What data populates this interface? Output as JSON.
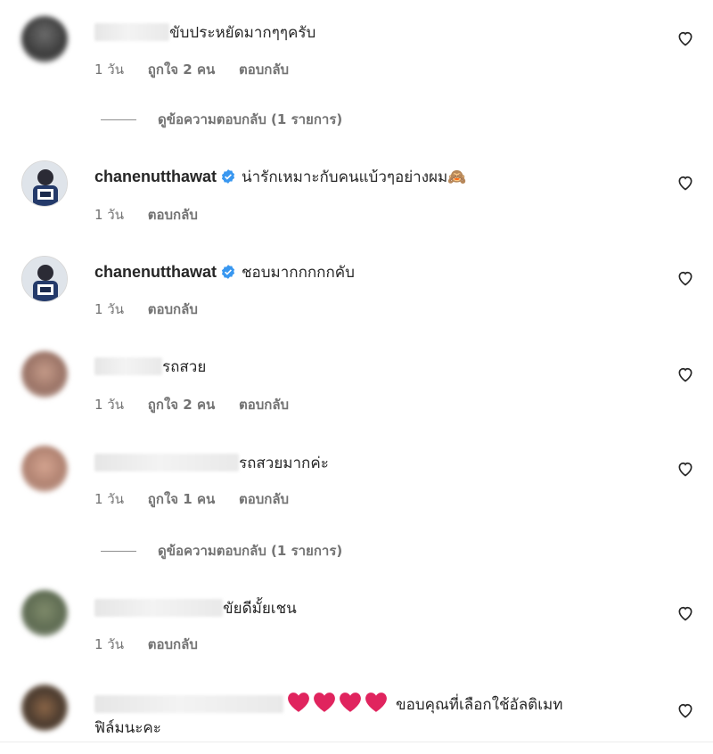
{
  "comments": [
    {
      "user_hidden": true,
      "text": "ขับประหยัดมากๆๆครับ",
      "time": "1 วัน",
      "likes": "ถูกใจ 2 คน",
      "reply": "ตอบกลับ"
    },
    {
      "username": "chanenutthawat",
      "text": "น่ารักเหมาะกับคนแบ้วๆอย่างผม🙈",
      "time": "1 วัน",
      "reply": "ตอบกลับ"
    },
    {
      "username": "chanenutthawat",
      "text": "ชอบมากกกกกคับ",
      "time": "1 วัน",
      "reply": "ตอบกลับ"
    },
    {
      "user_hidden": true,
      "text": "รถสวย",
      "time": "1 วัน",
      "likes": "ถูกใจ 2 คน",
      "reply": "ตอบกลับ"
    },
    {
      "user_hidden": true,
      "text": "รถสวยมากค่ะ",
      "time": "1 วัน",
      "likes": "ถูกใจ 1 คน",
      "reply": "ตอบกลับ"
    },
    {
      "user_hidden": true,
      "text": "ขัยดีมั้ยเชน",
      "time": "1 วัน",
      "reply": "ตอบกลับ"
    },
    {
      "user_hidden": true,
      "text_line1": "ขอบคุณที่เลือกใช้อัลติเมท",
      "text_line2": "ฟิล์มนะคะ"
    }
  ],
  "view_replies": [
    "ดูข้อความตอบกลับ (1 รายการ)",
    "ดูข้อความตอบกลับ (1 รายการ)"
  ],
  "colors": {
    "verified": "#3897f0",
    "heart_emoji": "#e0245e",
    "meta": "#737373"
  },
  "icons": {
    "like": "heart-outline-icon",
    "verified": "verified-badge-icon"
  }
}
